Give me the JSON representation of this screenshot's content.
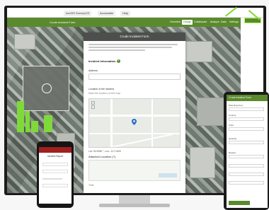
{
  "browser": {
    "tabs": [
      "ArcGIS Survey123",
      "Accessible",
      "Help"
    ]
  },
  "app": {
    "title": "Crude Incident Form",
    "nav": [
      "Overview",
      "Design",
      "Collaborate",
      "Analyze",
      "Data",
      "Settings"
    ],
    "active_nav": "Design"
  },
  "form": {
    "header": "Crude Incident Form",
    "section_incident": "Incident Information",
    "label_address": "Address",
    "label_location": "Location of the incident",
    "label_location_hint": "Mark the location on the map",
    "label_coords": "Lat: 34.0558 °, Lon: -117.1825",
    "section_upload": "Attached Location (?)",
    "footer_label": "Time"
  },
  "phone": {
    "title": "Incident Report"
  },
  "tablet": {
    "header": "Crude Incident Form",
    "labels": [
      "Date Reported",
      "Country",
      "Units",
      "Quantity",
      "Reason"
    ]
  },
  "colors": {
    "brand": "#5a8a2d",
    "accent": "#7fd93a",
    "phone_header": "#a11f1f"
  }
}
